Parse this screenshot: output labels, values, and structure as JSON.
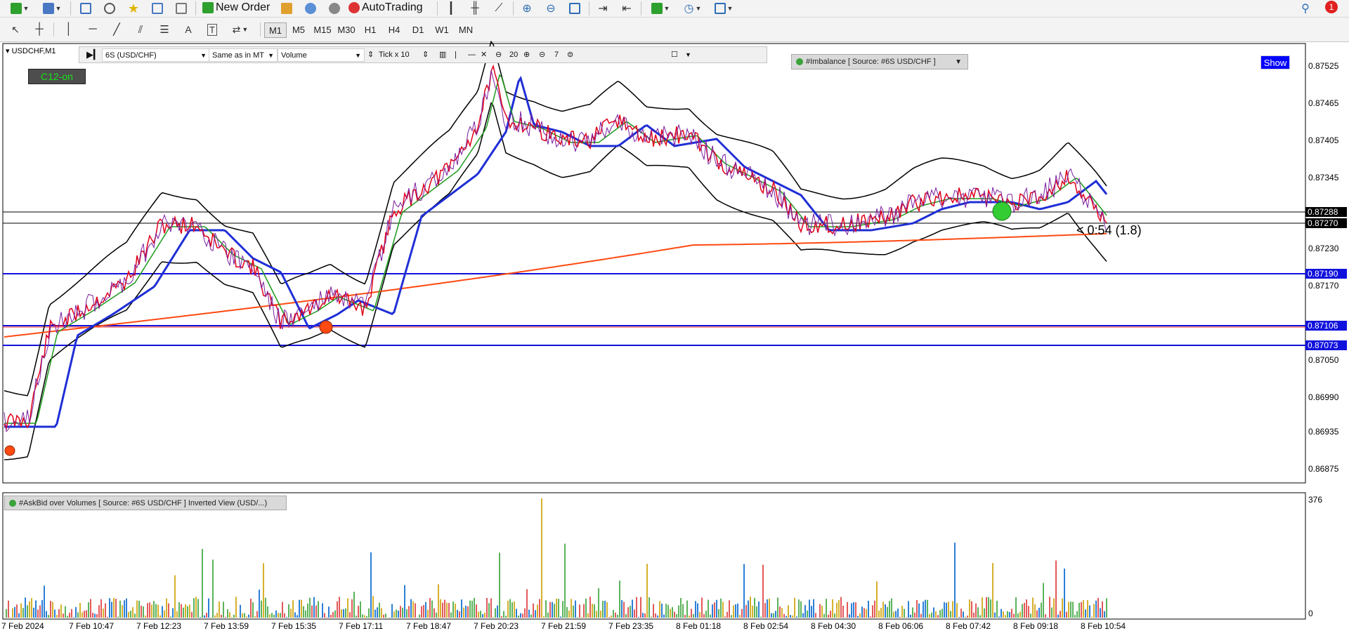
{
  "toolbar": {
    "new_order_label": "New Order",
    "autotrading_label": "AutoTrading",
    "notification_count": "1",
    "timeframes": [
      "M1",
      "M5",
      "M15",
      "M30",
      "H1",
      "H4",
      "D1",
      "W1",
      "MN"
    ],
    "active_timeframe": "M1"
  },
  "chart": {
    "symbol_label": "USDCHF,M1",
    "c12_label": "C12-on",
    "show_label": "Show",
    "countdown": "< 0:54 (1.8)",
    "imbalance_title": "#Imbalance [ Source: #6S USD/CHF ]",
    "subwindow_title": "#AskBid over Volumes [ Source: #6S USD/CHF ] Inverted View (USD/...)",
    "indicator_bar": {
      "source": "6S (USD/CHF)",
      "mode": "Same as in MT",
      "metric": "Volume",
      "tick": "Tick x 10",
      "zoom_value": "20",
      "zoom2_value": "7"
    },
    "colors": {
      "blue_ma": "#1f2fd6",
      "orange_ma": "#ff4a12",
      "price_line": "#e0001a",
      "band": "#000000",
      "level_line": "#1111dd"
    }
  },
  "price_axis": {
    "labels": [
      "0.87525",
      "0.87465",
      "0.87405",
      "0.87345",
      "0.87230",
      "0.87170",
      "0.87050",
      "0.86990",
      "0.86935",
      "0.86875"
    ],
    "tags": [
      {
        "text": "0.87288",
        "bg": "#000000",
        "fg": "#ffffff"
      },
      {
        "text": "0.87270",
        "bg": "#000000",
        "fg": "#ffffff"
      },
      {
        "text": "0.87190",
        "bg": "#1111dd",
        "fg": "#ffffff"
      },
      {
        "text": "0.87106",
        "bg": "#1111dd",
        "fg": "#ffffff"
      },
      {
        "text": "0.87073",
        "bg": "#1111dd",
        "fg": "#ffffff"
      }
    ],
    "sub_max": "376",
    "sub_min": "0"
  },
  "time_axis": [
    "7 Feb 2024",
    "7 Feb 10:47",
    "7 Feb 12:23",
    "7 Feb 13:59",
    "7 Feb 15:35",
    "7 Feb 17:11",
    "7 Feb 18:47",
    "7 Feb 20:23",
    "7 Feb 21:59",
    "7 Feb 23:35",
    "8 Feb 01:18",
    "8 Feb 02:54",
    "8 Feb 04:30",
    "8 Feb 06:06",
    "8 Feb 07:42",
    "8 Feb 09:18",
    "8 Feb 10:54"
  ]
}
